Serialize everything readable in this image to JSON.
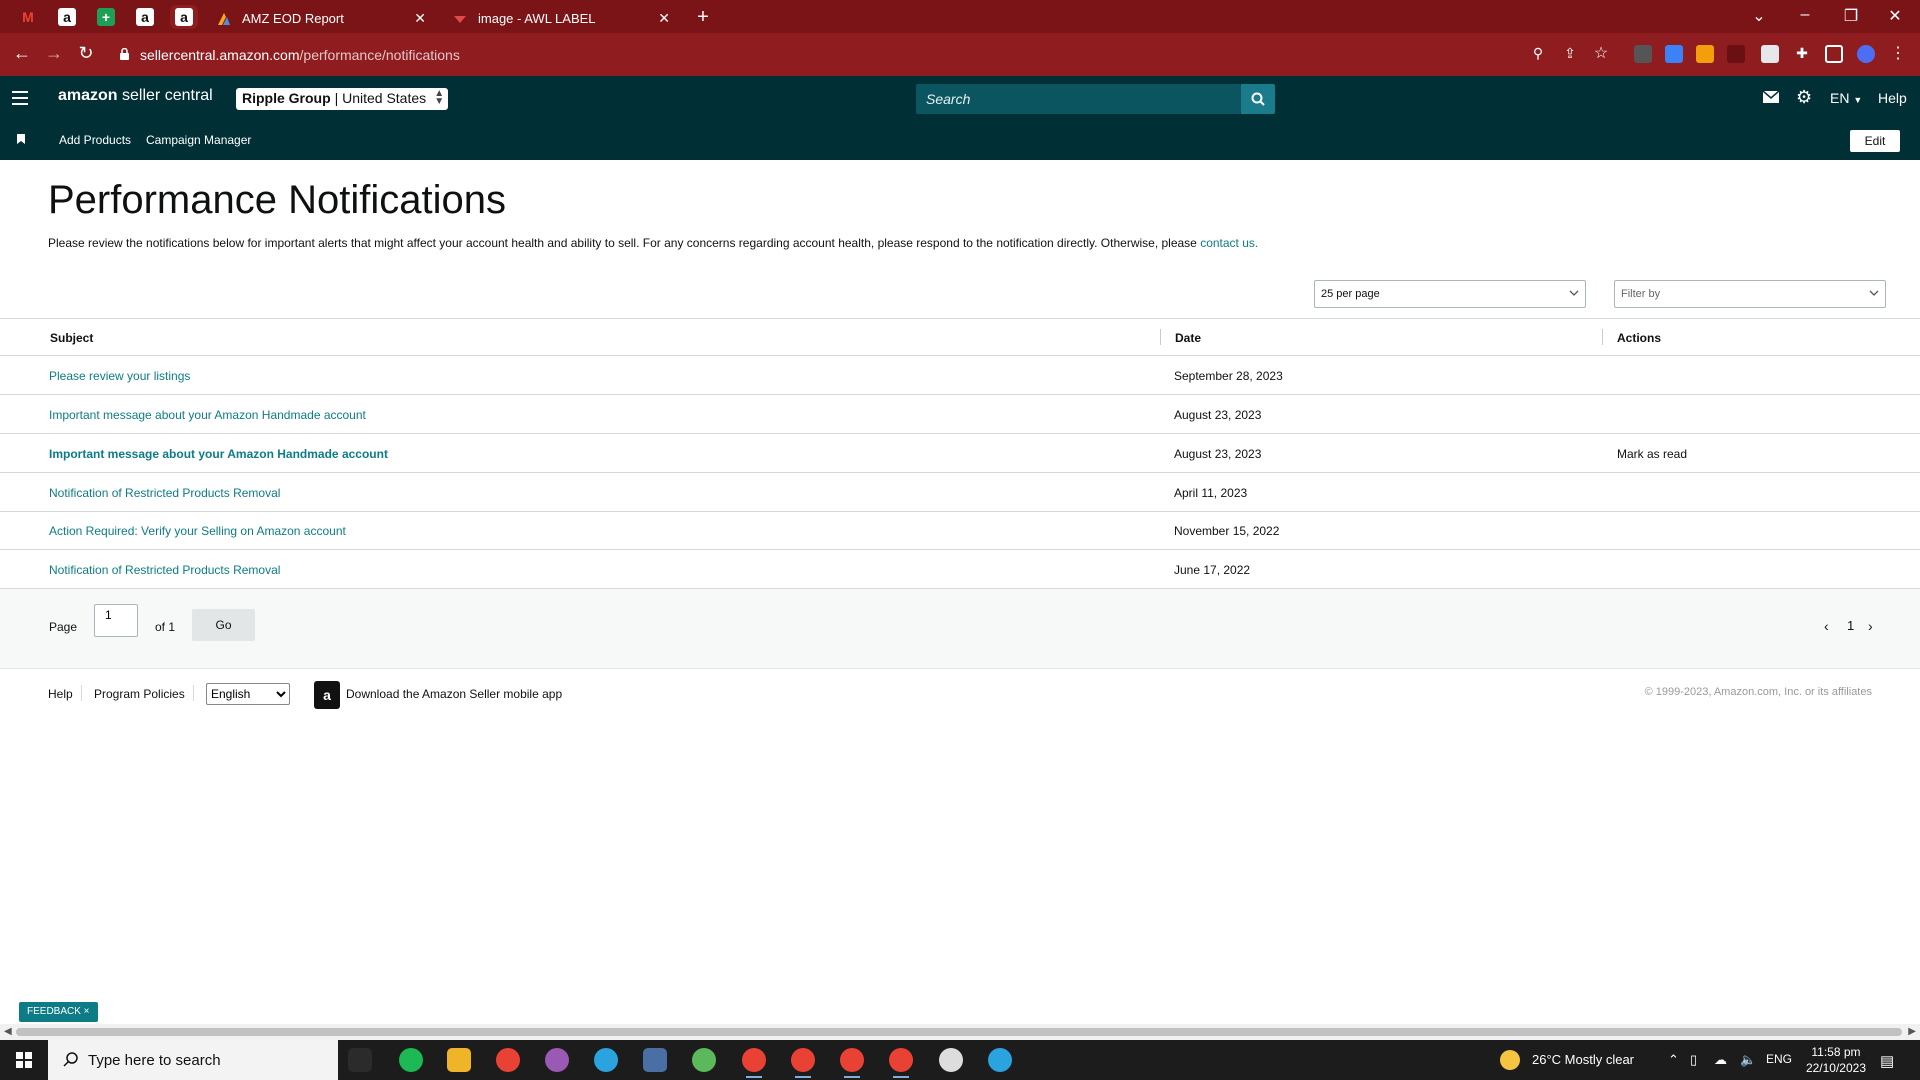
{
  "browser": {
    "tabs": [
      {
        "title": "AMZ EOD Report"
      },
      {
        "title": "image - AWL LABEL"
      }
    ],
    "url_host": "sellercentral.amazon.com",
    "url_path": "/performance/notifications"
  },
  "header": {
    "logo_bold": "amazon",
    "logo_text": " seller central",
    "account": "Ripple Group",
    "marketplace": "| United States",
    "search_placeholder": "Search",
    "language": "EN",
    "help": "Help"
  },
  "subnav": {
    "links": [
      "Add Products",
      "Campaign Manager"
    ],
    "edit_label": "Edit"
  },
  "page": {
    "title": "Performance Notifications",
    "intro": "Please review the notifications below for important alerts that might affect your account health and ability to sell. For any concerns regarding account health, please respond to the notification directly. Otherwise, please ",
    "intro_link": "contact us.",
    "per_page": "25 per page",
    "filter_placeholder": "Filter by"
  },
  "table": {
    "headers": {
      "subject": "Subject",
      "date": "Date",
      "actions": "Actions"
    },
    "rows": [
      {
        "subject": "Please review your listings",
        "date": "September 28, 2023",
        "action": "",
        "unread": false
      },
      {
        "subject": "Important message about your Amazon Handmade account",
        "date": "August 23, 2023",
        "action": "",
        "unread": false
      },
      {
        "subject": "Important message about your Amazon Handmade account",
        "date": "August 23, 2023",
        "action": "Mark as read",
        "unread": true
      },
      {
        "subject": "Notification of Restricted Products Removal",
        "date": "April 11, 2023",
        "action": "",
        "unread": false
      },
      {
        "subject": "Action Required: Verify your Selling on Amazon account",
        "date": "November 15, 2022",
        "action": "",
        "unread": false
      },
      {
        "subject": "Notification of Restricted Products Removal",
        "date": "June 17, 2022",
        "action": "",
        "unread": false
      }
    ]
  },
  "pagination": {
    "page_label": "Page",
    "page_value": "1",
    "of_label": "of 1",
    "go_label": "Go",
    "current": "1"
  },
  "footer": {
    "help": "Help",
    "policies": "Program Policies",
    "language": "English",
    "app_text": "Download the Amazon Seller mobile app",
    "copyright": "© 1999-2023, Amazon.com, Inc. or its affiliates"
  },
  "feedback": "FEEDBACK ×",
  "taskbar": {
    "search_placeholder": "Type here to search",
    "weather": "26°C  Mostly clear",
    "lang": "ENG",
    "time": "11:58 pm",
    "date": "22/10/2023"
  },
  "colors": {
    "tabbar": "#7a1416",
    "addrbar": "#8f1c1e",
    "sc_header": "#002f36",
    "link": "#0e7c86"
  }
}
